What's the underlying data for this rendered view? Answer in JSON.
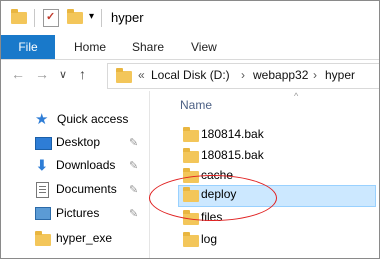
{
  "window": {
    "title": "hyper"
  },
  "ribbon": {
    "file": "File",
    "home": "Home",
    "share": "Share",
    "view": "View"
  },
  "nav": {
    "qa_arrow": "▾",
    "back": "←",
    "forward": "→",
    "dropdown": "∨",
    "up": "↑"
  },
  "address": {
    "overflow": "«",
    "crumbs": [
      "Local Disk (D:)",
      "webapp32",
      "hyper"
    ],
    "separator": "›"
  },
  "sidebar": {
    "items": [
      {
        "label": "Quick access",
        "icon": "star-icon"
      },
      {
        "label": "Desktop",
        "icon": "desktop-icon",
        "pinned": true
      },
      {
        "label": "Downloads",
        "icon": "download-icon",
        "pinned": true
      },
      {
        "label": "Documents",
        "icon": "documents-icon",
        "pinned": true
      },
      {
        "label": "Pictures",
        "icon": "pictures-icon",
        "pinned": true
      },
      {
        "label": "hyper_exe",
        "icon": "folder-icon"
      }
    ],
    "pin_glyph": "📌"
  },
  "files": {
    "column_name": "Name",
    "sort_glyph": "^",
    "rows": [
      {
        "name": "180814.bak"
      },
      {
        "name": "180815.bak"
      },
      {
        "name": "cache"
      },
      {
        "name": "deploy",
        "selected": true
      },
      {
        "name": "files"
      },
      {
        "name": "log"
      }
    ]
  },
  "colors": {
    "accent": "#1979ca",
    "folder": "#f3c65a",
    "selection": "#cce8ff",
    "highlight_circle": "#e02020"
  }
}
